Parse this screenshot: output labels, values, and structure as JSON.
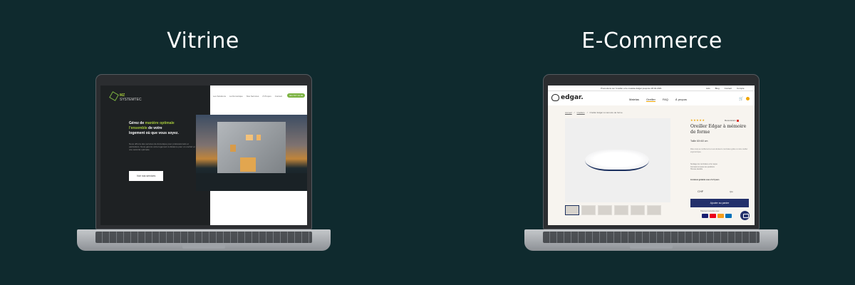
{
  "headings": {
    "left": "Vitrine",
    "right": "E-Commerce"
  },
  "vitrine": {
    "logo": {
      "name": "MZ",
      "sub": "SYSTEMTEC"
    },
    "nav": [
      "Les Solutions",
      "La Domotique",
      "Nos Services",
      "À Propos",
      "Contact"
    ],
    "nav_cta": "021 577 13 09",
    "hero_title_1": "Gérez de ",
    "hero_title_highlight_1": "manière optimale",
    "hero_title_2": " l'ensemble",
    "hero_title_3": " de votre",
    "hero_title_4": "logement où que vous soyez.",
    "hero_text": "Nous offrons des services de domotique pour professionnels et particuliers. Nous gérons votre logement à distance pour un confort et une sécurité optimale.",
    "hero_button": "Voir nos services"
  },
  "ecommerce": {
    "promo": "Promotions sur l'oreiller et le matelas Edgar jusqu'au 28.02.2021",
    "top_links": [
      "Avis",
      "Blog",
      "Contact",
      "Compte"
    ],
    "logo": "edgar.",
    "nav": [
      "Matelas",
      "Oreiller",
      "FAQ",
      "À propos"
    ],
    "nav_active": "Oreiller",
    "breadcrumb": [
      "Accueil",
      "Oreillers",
      "Oreiller Edgar à mémoire de forme"
    ],
    "stars": "★★★★★",
    "reviews": "Recensions",
    "product_title": "Oreiller Edgar à mémoire de forme",
    "size": "Taille 60×60 cm",
    "description": "Dites stop au ronflement et aux douleurs cervicales grâce à notre oreiller ergonomique.",
    "bullets": [
      "Soulage les cervicales et la nuque",
      "Convient à toutes les positions",
      "Housse lavable"
    ],
    "delivery": "Livraison gratuite sous 2 à 5 jours",
    "price": "CHF",
    "quantity": "Qté",
    "add_to_cart": "Ajouter au panier",
    "payment_label": "Paiement sécurisé avec",
    "card_colors": [
      "#1a1f71",
      "#eb001b",
      "#f79e1b",
      "#0070ba"
    ],
    "colors": {
      "primary": "#23306b",
      "accent": "#f0a500"
    }
  }
}
